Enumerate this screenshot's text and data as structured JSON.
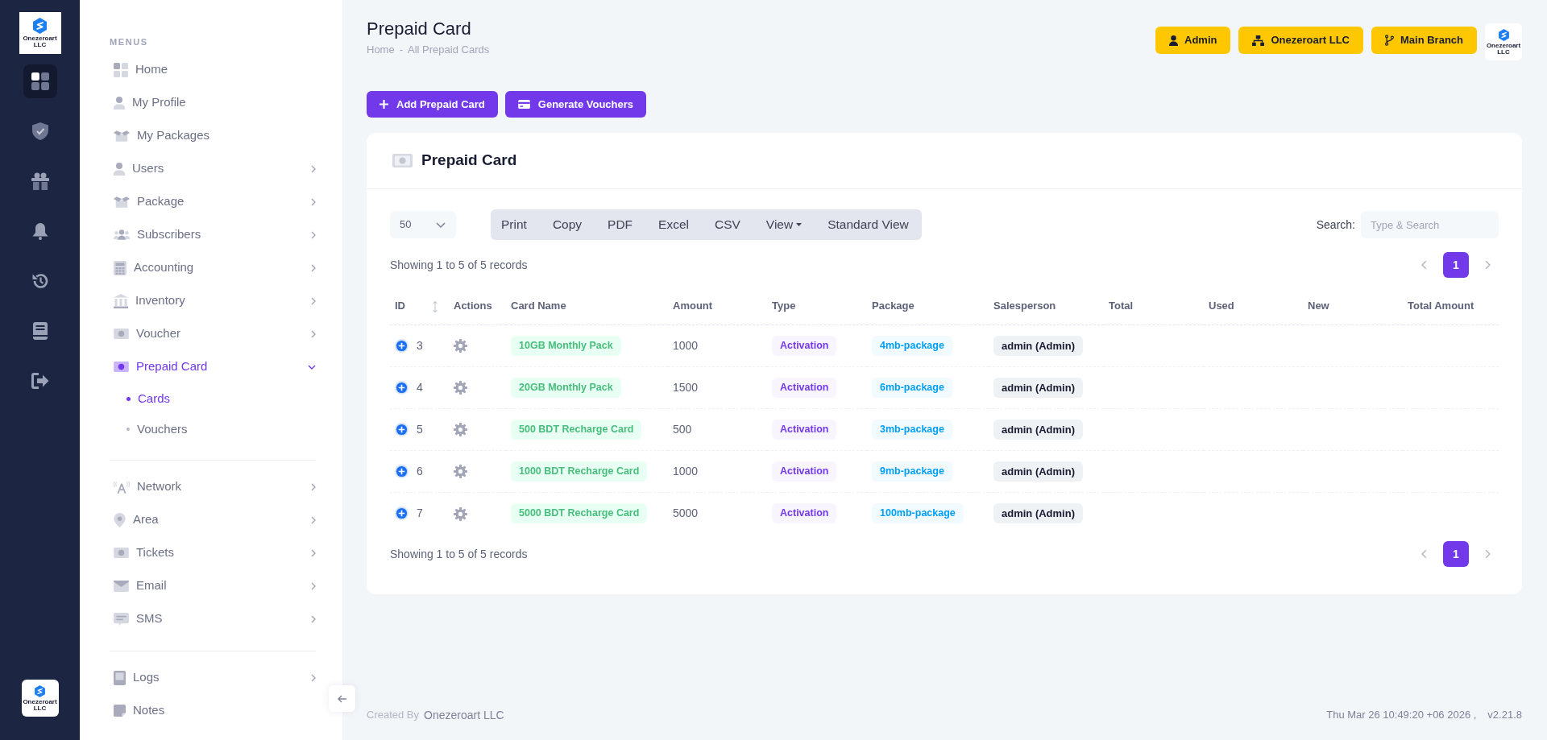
{
  "rail": {
    "logo_caption": "Onezeroart LLC",
    "items": [
      {
        "selected": true
      },
      {
        "selected": false
      },
      {
        "selected": false
      },
      {
        "selected": false
      },
      {
        "selected": false
      },
      {
        "selected": false
      },
      {
        "selected": false
      }
    ],
    "bottom_logo_caption": "Onezeroart LLC"
  },
  "sidebar": {
    "sections": [
      {
        "heading": "MENUS",
        "items": [
          {
            "label": "Home",
            "has_submenu": false,
            "expanded": false,
            "selected": false
          },
          {
            "label": "My Profile",
            "has_submenu": false,
            "expanded": false,
            "selected": false
          },
          {
            "label": "My Packages",
            "has_submenu": false,
            "expanded": false,
            "selected": false
          },
          {
            "label": "Users",
            "has_submenu": true,
            "expanded": false,
            "selected": false
          },
          {
            "label": "Package",
            "has_submenu": true,
            "expanded": false,
            "selected": false
          },
          {
            "label": "Subscribers",
            "has_submenu": true,
            "expanded": false,
            "selected": false
          },
          {
            "label": "Accounting",
            "has_submenu": true,
            "expanded": false,
            "selected": false
          },
          {
            "label": "Inventory",
            "has_submenu": true,
            "expanded": false,
            "selected": false
          },
          {
            "label": "Voucher",
            "has_submenu": true,
            "expanded": false,
            "selected": false
          },
          {
            "label": "Prepaid Card",
            "has_submenu": true,
            "expanded": true,
            "selected": true,
            "children": [
              {
                "label": "Cards",
                "selected": true
              },
              {
                "label": "Vouchers",
                "selected": false
              }
            ]
          }
        ]
      },
      {
        "items": [
          {
            "label": "Network",
            "has_submenu": true,
            "expanded": false,
            "selected": false
          },
          {
            "label": "Area",
            "has_submenu": true,
            "expanded": false,
            "selected": false
          },
          {
            "label": "Tickets",
            "has_submenu": true,
            "expanded": false,
            "selected": false
          },
          {
            "label": "Email",
            "has_submenu": true,
            "expanded": false,
            "selected": false
          },
          {
            "label": "SMS",
            "has_submenu": true,
            "expanded": false,
            "selected": false
          }
        ]
      },
      {
        "items": [
          {
            "label": "Logs",
            "has_submenu": true,
            "expanded": false,
            "selected": false
          },
          {
            "label": "Notes",
            "has_submenu": false,
            "expanded": false,
            "selected": false
          }
        ]
      }
    ]
  },
  "header": {
    "title": "Prepaid Card",
    "breadcrumb": [
      {
        "label": "Home"
      },
      {
        "label": "All Prepaid Cards"
      }
    ],
    "breadcrumb_separator": "-",
    "buttons": [
      {
        "label": "Admin"
      },
      {
        "label": "Onezeroart LLC"
      },
      {
        "label": "Main Branch"
      }
    ],
    "logo_caption": "Onezeroart LLC"
  },
  "actions": [
    {
      "label": "Add Prepaid Card"
    },
    {
      "label": "Generate Vouchers"
    }
  ],
  "card": {
    "title": "Prepaid Card",
    "page_size": "50",
    "export_buttons": [
      {
        "label": "Print",
        "dropdown": false
      },
      {
        "label": "Copy",
        "dropdown": false
      },
      {
        "label": "PDF",
        "dropdown": false
      },
      {
        "label": "Excel",
        "dropdown": false
      },
      {
        "label": "CSV",
        "dropdown": false
      },
      {
        "label": "View",
        "dropdown": true
      },
      {
        "label": "Standard View",
        "dropdown": false
      }
    ],
    "search": {
      "label": "Search:",
      "placeholder": "Type & Search"
    },
    "info_top": "Showing 1 to 5 of 5 records",
    "pagination_top": [
      {
        "label": "1",
        "selected": true
      }
    ],
    "table": {
      "columns": [
        {
          "label": "ID",
          "sortable": true
        },
        {
          "label": "Actions",
          "sortable": false
        },
        {
          "label": "Card Name",
          "sortable": false
        },
        {
          "label": "Amount",
          "sortable": false
        },
        {
          "label": "Type",
          "sortable": false
        },
        {
          "label": "Package",
          "sortable": false
        },
        {
          "label": "Salesperson",
          "sortable": false
        },
        {
          "label": "Total",
          "sortable": false
        },
        {
          "label": "Used",
          "sortable": false
        },
        {
          "label": "New",
          "sortable": false
        },
        {
          "label": "Total Amount",
          "sortable": false
        }
      ],
      "rows": [
        {
          "id": "3",
          "card_name": "10GB Monthly Pack",
          "amount": "1000",
          "type": "Activation",
          "package": "4mb-package",
          "salesperson": "admin (Admin)"
        },
        {
          "id": "4",
          "card_name": "20GB Monthly Pack",
          "amount": "1500",
          "type": "Activation",
          "package": "6mb-package",
          "salesperson": "admin (Admin)"
        },
        {
          "id": "5",
          "card_name": "500 BDT Recharge Card",
          "amount": "500",
          "type": "Activation",
          "package": "3mb-package",
          "salesperson": "admin (Admin)"
        },
        {
          "id": "6",
          "card_name": "1000 BDT Recharge Card",
          "amount": "1000",
          "type": "Activation",
          "package": "9mb-package",
          "salesperson": "admin (Admin)"
        },
        {
          "id": "7",
          "card_name": "5000 BDT Recharge Card",
          "amount": "5000",
          "type": "Activation",
          "package": "100mb-package",
          "salesperson": "admin (Admin)"
        }
      ]
    },
    "info_bottom": "Showing 1 to 5 of 5 records",
    "pagination_bottom": [
      {
        "label": "1",
        "selected": true
      }
    ]
  },
  "footer": {
    "created_by_label": "Created By",
    "created_by": "Onezeroart LLC",
    "timestamp": "Thu Mar 26 10:49:20 +06 2026 ,",
    "version": "v2.21.8"
  }
}
